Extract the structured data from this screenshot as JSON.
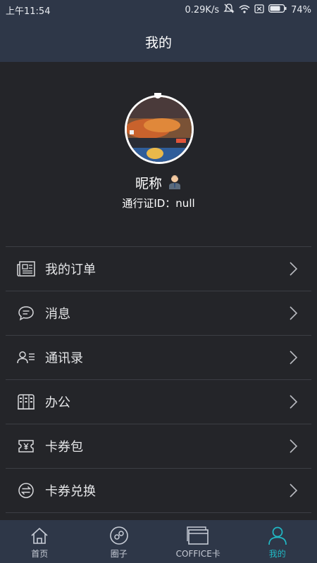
{
  "status_bar": {
    "time": "上午11:54",
    "net_speed": "0.29K/s",
    "battery": "74%"
  },
  "header": {
    "title": "我的"
  },
  "profile": {
    "nickname": "昵称",
    "pass_id": "通行证ID：null"
  },
  "menu": [
    {
      "label": "我的订单",
      "icon": "newspaper-icon"
    },
    {
      "label": "消息",
      "icon": "chat-bubble-icon"
    },
    {
      "label": "通讯录",
      "icon": "contacts-icon"
    },
    {
      "label": "办公",
      "icon": "office-building-icon"
    },
    {
      "label": "卡券包",
      "icon": "coupon-icon"
    },
    {
      "label": "卡券兑换",
      "icon": "exchange-icon"
    }
  ],
  "tabs": [
    {
      "label": "首页",
      "icon": "home-icon",
      "active": false
    },
    {
      "label": "圈子",
      "icon": "circle-icon",
      "active": false
    },
    {
      "label": "COFFICE卡",
      "icon": "card-icon",
      "active": false
    },
    {
      "label": "我的",
      "icon": "person-icon",
      "active": true
    }
  ],
  "colors": {
    "accent": "#21b9c5",
    "header_bg": "#2e3748",
    "page_bg": "#242529"
  }
}
